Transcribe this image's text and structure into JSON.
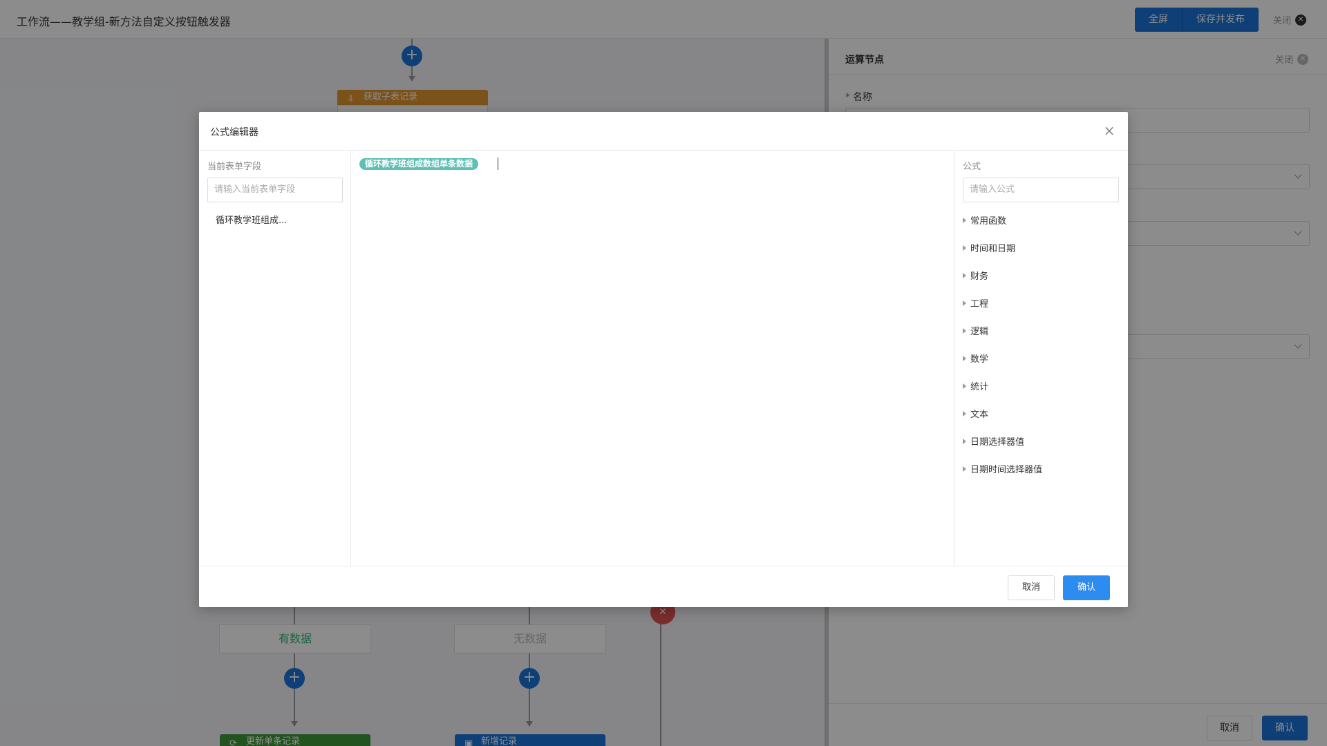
{
  "topbar": {
    "title": "工作流——教学组-新方法自定义按钮触发器",
    "fullscreen_label": "全屏",
    "save_publish_label": "保存并发布",
    "close_label": "关闭"
  },
  "canvas": {
    "node_get_subtable": "获取子表记录",
    "branch_has_data": "有数据",
    "branch_no_data": "无数据",
    "node_update_single": "更新单条记录",
    "node_add_record": "新增记录",
    "plus_symbol": "+"
  },
  "right_panel": {
    "title": "运算节点",
    "close_label": "关闭",
    "name_label": "名称",
    "required_mark": "*",
    "cancel_label": "取消",
    "confirm_label": "确认"
  },
  "modal": {
    "title": "公式编辑器",
    "close_symbol": "×",
    "left": {
      "label": "当前表单字段",
      "placeholder": "请输入当前表单字段",
      "items": [
        "循环教学班组成..."
      ]
    },
    "editor": {
      "chip_text": "循环教学班组成数组单条数据"
    },
    "right": {
      "label": "公式",
      "placeholder": "请输入公式",
      "categories": [
        "常用函数",
        "时间和日期",
        "财务",
        "工程",
        "逻辑",
        "数学",
        "统计",
        "文本",
        "日期选择器值",
        "日期时间选择器值"
      ]
    },
    "footer": {
      "cancel_label": "取消",
      "confirm_label": "确认"
    }
  },
  "colors": {
    "primary": "#1a73d9",
    "modal_primary": "#2d8cf0",
    "chip": "#5ec0b4",
    "node_orange": "#e0962f",
    "node_green": "#3f9a3a",
    "node_blue": "#1a73d9",
    "branch_green": "#2bb673",
    "danger": "#e05252"
  }
}
